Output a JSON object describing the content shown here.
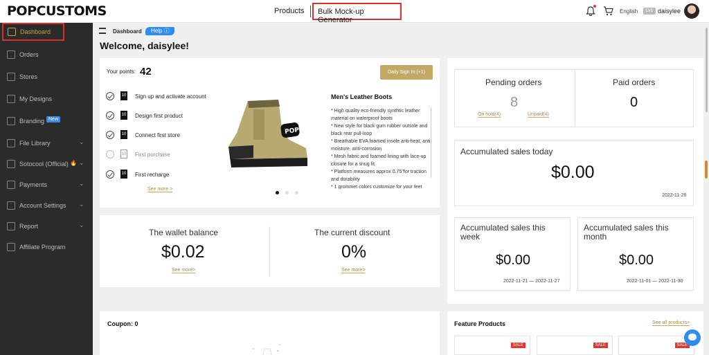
{
  "header": {
    "logo": "POPCUSTOMS",
    "nav_products": "Products",
    "nav_bulk": "Bulk Mock-up Generator",
    "language": "English",
    "level_badge": "LV1",
    "username": "daisylee"
  },
  "sidebar": {
    "items": [
      {
        "label": "Dashboard",
        "icon": "monitor-icon"
      },
      {
        "label": "Orders",
        "icon": "list-icon"
      },
      {
        "label": "Stores",
        "icon": "store-icon"
      },
      {
        "label": "My Designs",
        "icon": "brush-icon"
      },
      {
        "label": "Branding",
        "icon": "tag-icon",
        "badge": "New"
      },
      {
        "label": "File Library",
        "icon": "folder-icon"
      },
      {
        "label": "Sotocool (Official)",
        "icon": "circle-icon",
        "badge": "🔥"
      },
      {
        "label": "Payments",
        "icon": "wallet-icon"
      },
      {
        "label": "Account Settings",
        "icon": "gear-icon"
      },
      {
        "label": "Report",
        "icon": "chart-icon"
      },
      {
        "label": "Affiliate Program",
        "icon": "share-icon"
      }
    ]
  },
  "breadcrumb": {
    "label": "Dashboard",
    "help": "Help ⓘ"
  },
  "welcome": "Welcome, daisylee!",
  "points": {
    "label": "Your points:",
    "value": "42",
    "button": "Daily Sign In (+1)",
    "tasks": [
      {
        "label": "Sign up and activate account",
        "done": true
      },
      {
        "label": "Design first product",
        "done": true
      },
      {
        "label": "Connect first store",
        "done": true
      },
      {
        "label": "First purchase",
        "done": false
      },
      {
        "label": "First recharge",
        "done": true
      }
    ],
    "see_more": "See more >"
  },
  "product": {
    "title": "Men's Leather Boots",
    "description": "* High quality eco-friendly synthtic leather material on waterproof boots\n* New style for black gum rubber outsole and black rear pull-loop\n* Breathable EVA foamed insole anti-heat, anti-moisture, anti-corrosion\n* Mesh fabric and foamed lining with lace-up closure for a snug fit\n* Platform measures approx 0.75\"for traction and durability\n* 1 grommet colors customize for your feet"
  },
  "wallet": {
    "label": "The wallet balance",
    "value": "$0.02",
    "see_more": "See more>"
  },
  "discount": {
    "label": "The current discount",
    "value": "0%",
    "see_more": "See more>"
  },
  "orders": {
    "pending_label": "Pending orders",
    "pending_value": "8",
    "on_hold": "On hold(4)",
    "unpaid": "Unpaid(4)",
    "paid_label": "Paid orders",
    "paid_value": "0"
  },
  "sales_today": {
    "label": "Accumulated sales today",
    "value": "$0.00",
    "date": "2022-11-26"
  },
  "sales_week": {
    "label": "Accumulated sales this week",
    "value": "$0.00",
    "date": "2022-11-21 — 2022-11-27"
  },
  "sales_month": {
    "label": "Accumulated sales this month",
    "value": "$0.00",
    "date": "2022-11-01 — 2022-11-30"
  },
  "coupon": {
    "label": "Coupon: 0"
  },
  "featured": {
    "label": "Feature Products",
    "link": "See all products>",
    "sale_badge": "SALE"
  },
  "colors": {
    "accent": "#c3a765",
    "sidebar": "#2b2b2b",
    "highlight": "#d9322c",
    "help": "#2f8df0"
  }
}
